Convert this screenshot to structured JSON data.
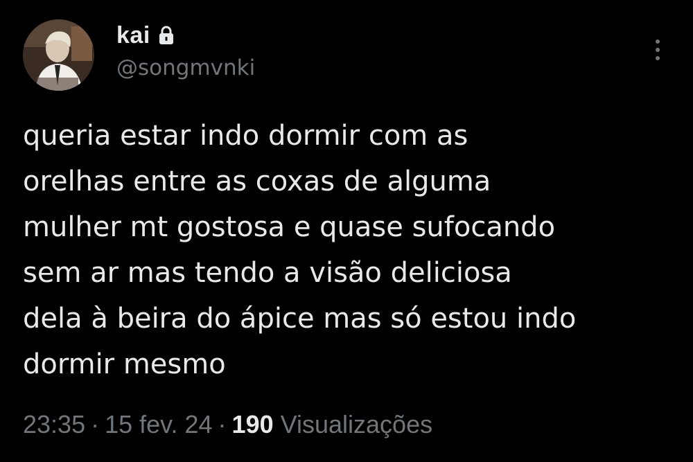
{
  "author": {
    "display_name": "kai",
    "handle": "@songmvnki",
    "protected_icon": "lock-icon",
    "avatar_icon": "profile-photo"
  },
  "more_menu_icon": "more-vertical-icon",
  "tweet": {
    "text": "queria estar indo dormir com as\norelhas entre as coxas de alguma\nmulher mt gostosa e quase sufocando\nsem ar mas tendo a visão deliciosa\ndela à beira do ápice mas só estou indo\ndormir mesmo"
  },
  "meta": {
    "time": "23:35",
    "separator": "·",
    "date": "15 fev. 24",
    "views_count": "190",
    "views_label": "Visualizações"
  },
  "colors": {
    "background": "#000000",
    "primary_text": "#e7e9ea",
    "secondary_text": "#71767b"
  }
}
